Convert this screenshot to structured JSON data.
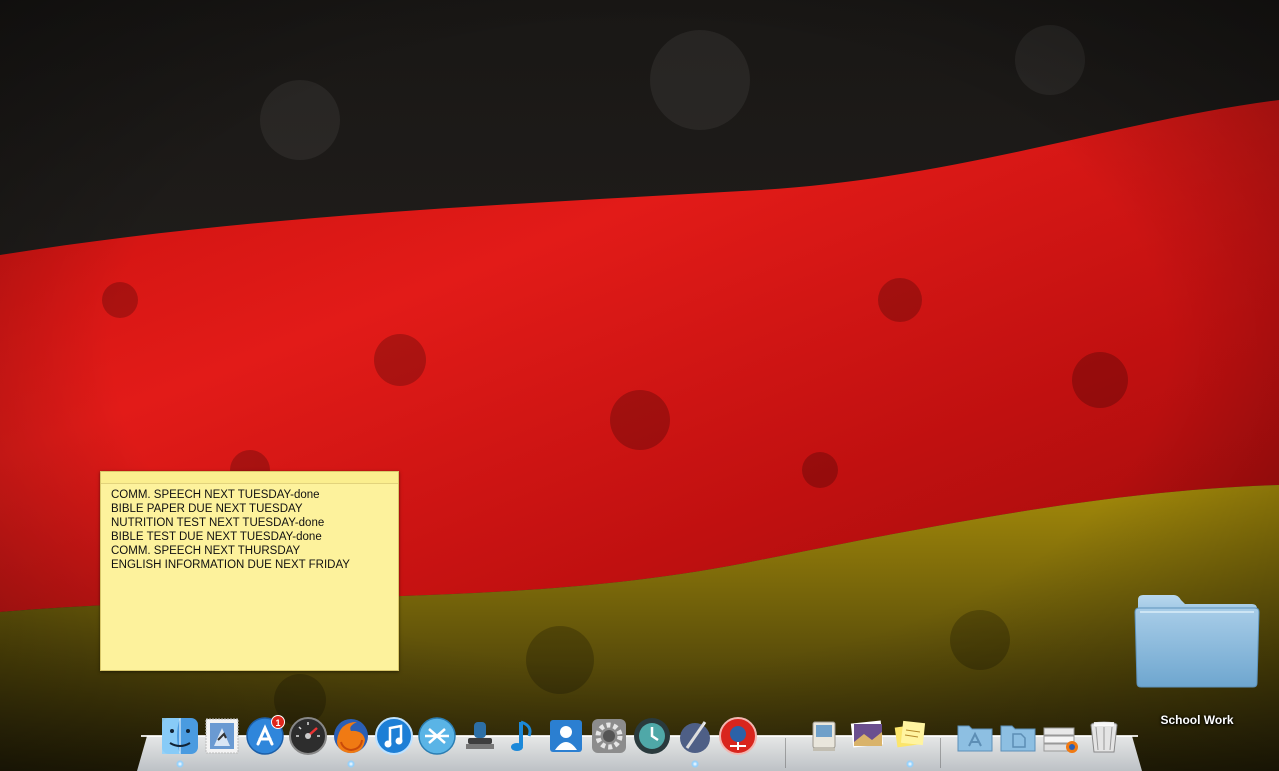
{
  "desktop": {
    "wallpaper": {
      "name": "german-flag-wallpaper",
      "colors": {
        "black": "#1c1a17",
        "red": "#d81212",
        "gold": "#b99b0c"
      }
    },
    "sticky_note": {
      "color": "#fdf29c",
      "lines": [
        "COMM. SPEECH NEXT TUESDAY-done",
        "BIBLE PAPER DUE NEXT TUESDAY",
        "NUTRITION TEST NEXT TUESDAY-done",
        "BIBLE TEST DUE NEXT TUESDAY-done",
        "COMM. SPEECH NEXT THURSDAY",
        "ENGLISH INFORMATION DUE NEXT FRIDAY"
      ]
    },
    "folder": {
      "label": "School Work",
      "icon": "folder-icon"
    }
  },
  "dock": {
    "apps": [
      {
        "name": "finder",
        "icon": "finder-icon",
        "running": true
      },
      {
        "name": "mail",
        "icon": "mail-stamp-icon",
        "running": false
      },
      {
        "name": "app-store",
        "icon": "app-store-icon",
        "running": false,
        "badge": "1"
      },
      {
        "name": "dashboard",
        "icon": "dashboard-gauge-icon",
        "running": false
      },
      {
        "name": "firefox",
        "icon": "firefox-icon",
        "running": true
      },
      {
        "name": "itunes",
        "icon": "itunes-note-icon",
        "running": false
      },
      {
        "name": "x-lite",
        "icon": "x-lite-icon",
        "running": false
      },
      {
        "name": "stamp-app",
        "icon": "stamp-icon",
        "running": false
      },
      {
        "name": "music-app",
        "icon": "blue-note-icon",
        "running": false
      },
      {
        "name": "address-book",
        "icon": "address-book-icon",
        "running": false
      },
      {
        "name": "system-preferences",
        "icon": "gear-icon",
        "running": false
      },
      {
        "name": "time-machine",
        "icon": "time-machine-icon",
        "running": false
      },
      {
        "name": "script-editor",
        "icon": "quill-icon",
        "running": true
      },
      {
        "name": "scrobbler",
        "icon": "red-scrobbler-icon",
        "running": false
      }
    ],
    "stacks": [
      {
        "name": "classic-mac",
        "icon": "classic-mac-icon"
      },
      {
        "name": "photo-stack",
        "icon": "photo-stack-icon"
      },
      {
        "name": "stickies",
        "icon": "stickies-icon",
        "running": true
      },
      {
        "name": "applications-folder",
        "icon": "applications-folder-icon"
      },
      {
        "name": "documents-folder",
        "icon": "documents-folder-icon"
      },
      {
        "name": "downloads-stack",
        "icon": "downloads-stack-icon"
      },
      {
        "name": "trash",
        "icon": "trash-icon"
      }
    ]
  }
}
